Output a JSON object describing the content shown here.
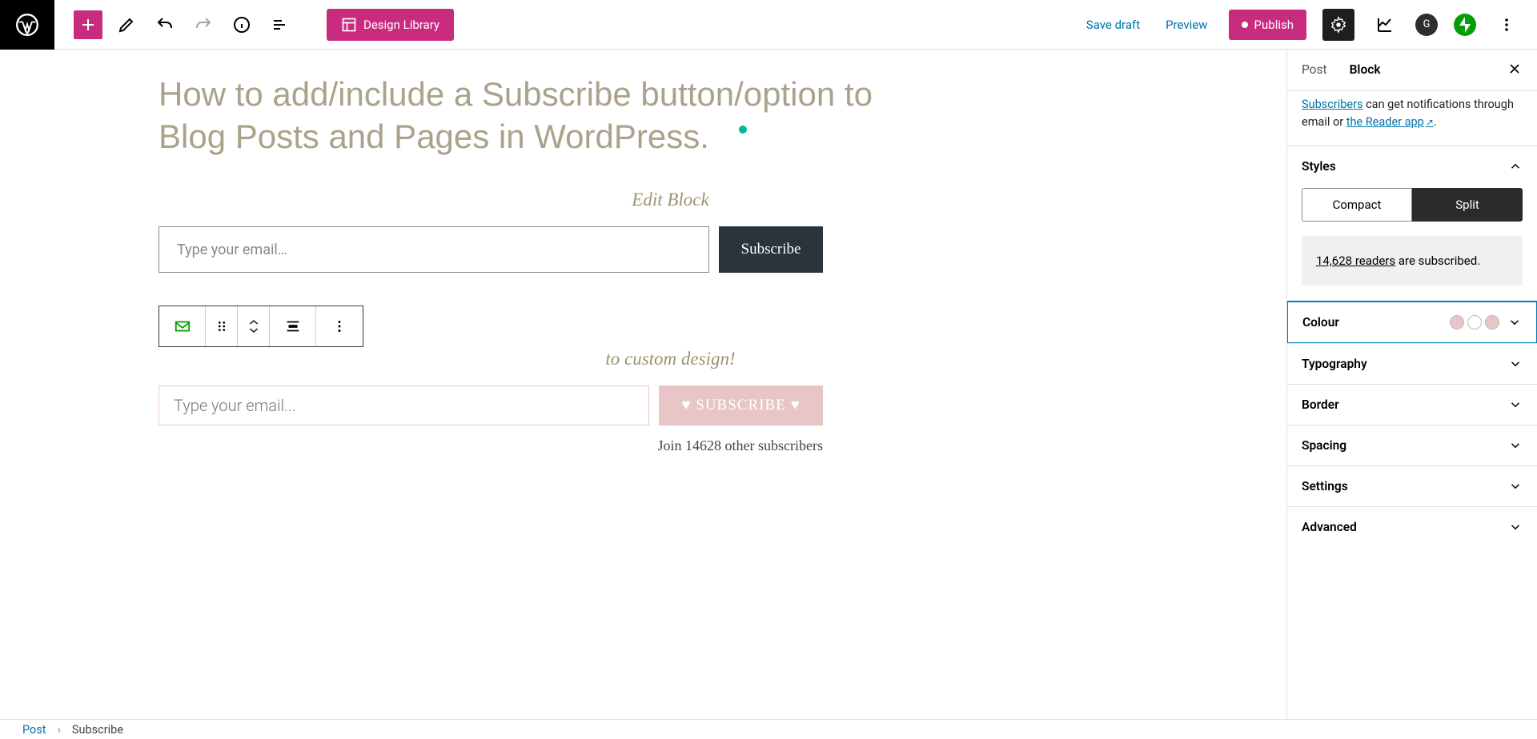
{
  "toolbar": {
    "design_library": "Design Library",
    "save_draft": "Save draft",
    "preview": "Preview",
    "publish": "Publish",
    "avatar_letter": "G"
  },
  "post": {
    "title": "How to add/include a Subscribe button/option to Blog Posts and Pages in WordPress.",
    "edit_block_label": "Edit Block",
    "custom_design_label": "to custom design!",
    "email_placeholder": "Type your email…",
    "subscribe_dark": "Subscribe",
    "email_placeholder2": "Type your email...",
    "subscribe_pink": "♥ SUBSCRIBE ♥",
    "join_text": "Join 14628 other subscribers"
  },
  "sidebar": {
    "tabs": {
      "post": "Post",
      "block": "Block"
    },
    "intro": {
      "subscribers": "Subscribers",
      "middle": " can get notifications through email or ",
      "reader": "the Reader app",
      "tail": "."
    },
    "styles": {
      "title": "Styles",
      "compact": "Compact",
      "split": "Split",
      "readers_count": "14,628 readers",
      "readers_tail": " are subscribed."
    },
    "sections": {
      "colour": "Colour",
      "typography": "Typography",
      "border": "Border",
      "spacing": "Spacing",
      "settings": "Settings",
      "advanced": "Advanced"
    },
    "swatches": [
      "#e8c6c8",
      "#ffffff",
      "#e8c6c8"
    ]
  },
  "breadcrumb": {
    "root": "Post",
    "current": "Subscribe"
  }
}
